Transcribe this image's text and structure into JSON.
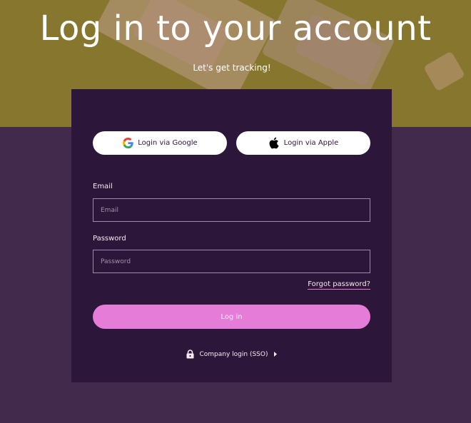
{
  "hero": {
    "title": "Log in to your account",
    "subtitle": "Let's get tracking!"
  },
  "social": {
    "google_label": "Login via Google",
    "apple_label": "Login via Apple"
  },
  "form": {
    "email_label": "Email",
    "email_placeholder": "Email",
    "password_label": "Password",
    "password_placeholder": "Password",
    "forgot_label": "Forgot password?",
    "login_label": "Log in"
  },
  "company_login": {
    "label": "Company login (SSO)"
  },
  "icons": {
    "google": "google-icon",
    "apple": "apple-icon",
    "lock": "lock-icon",
    "caret": "caret-right-icon"
  },
  "colors": {
    "hero_bg": "#87762d",
    "page_bg": "#412a4c",
    "card_bg": "#2c1639",
    "accent": "#e57cd8",
    "text_light": "#fce8f2"
  }
}
